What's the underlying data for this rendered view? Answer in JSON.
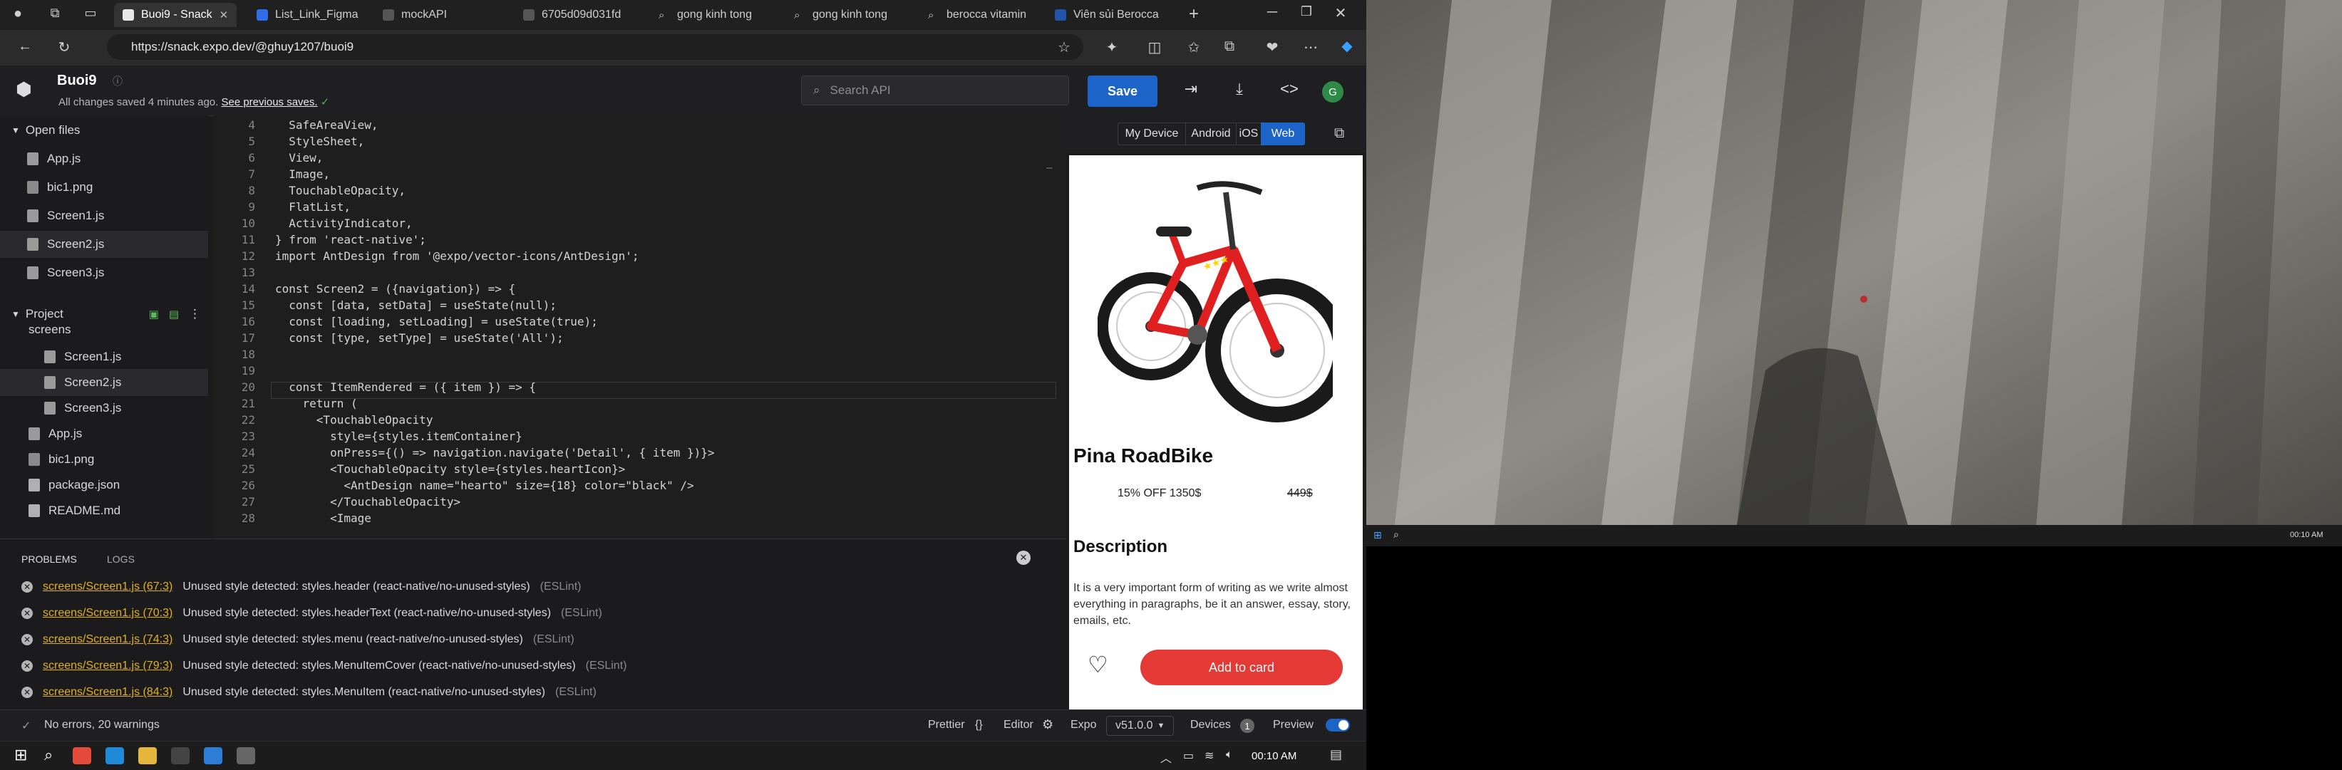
{
  "browser": {
    "tabs": [
      {
        "title": "Buoi9 - Snack",
        "active": true
      },
      {
        "title": "List_Link_Figma"
      },
      {
        "title": "mockAPI"
      },
      {
        "title": "6705d09d031fd"
      },
      {
        "title": "gong kinh tong"
      },
      {
        "title": "gong kinh tong"
      },
      {
        "title": "berocca vitamin"
      },
      {
        "title": "Viên sủi Berocca"
      }
    ],
    "url": "https://snack.expo.dev/@ghuy1207/buoi9"
  },
  "snack": {
    "project_name": "Buoi9",
    "saved_status": "All changes saved 4 minutes ago.",
    "previous_saves_link": "See previous saves.",
    "search_placeholder": "Search API",
    "save_label": "Save",
    "avatar_letter": "G"
  },
  "sidebar": {
    "open_files_title": "Open files",
    "open_files": [
      "App.js",
      "bic1.png",
      "Screen1.js",
      "Screen2.js",
      "Screen3.js"
    ],
    "project_title": "Project",
    "folder_name": "screens",
    "screen_files": [
      "Screen1.js",
      "Screen2.js",
      "Screen3.js"
    ],
    "root_files": [
      "App.js",
      "bic1.png",
      "package.json",
      "README.md"
    ]
  },
  "editor": {
    "lines": [
      {
        "n": "4",
        "text": "  SafeAreaView,"
      },
      {
        "n": "5",
        "text": "  StyleSheet,"
      },
      {
        "n": "6",
        "text": "  View,"
      },
      {
        "n": "7",
        "text": "  Image,"
      },
      {
        "n": "8",
        "text": "  TouchableOpacity,"
      },
      {
        "n": "9",
        "text": "  FlatList,"
      },
      {
        "n": "10",
        "text": "  ActivityIndicator,"
      },
      {
        "n": "11",
        "text": "} from 'react-native';"
      },
      {
        "n": "12",
        "text": "import AntDesign from '@expo/vector-icons/AntDesign';"
      },
      {
        "n": "13",
        "text": ""
      },
      {
        "n": "14",
        "text": "const Screen2 = ({navigation}) => {"
      },
      {
        "n": "15",
        "text": "  const [data, setData] = useState(null);"
      },
      {
        "n": "16",
        "text": "  const [loading, setLoading] = useState(true);"
      },
      {
        "n": "17",
        "text": "  const [type, setType] = useState('All');"
      },
      {
        "n": "18",
        "text": ""
      },
      {
        "n": "19",
        "text": ""
      },
      {
        "n": "20",
        "text": "  const ItemRendered = ({ item }) => {"
      },
      {
        "n": "21",
        "text": "    return ("
      },
      {
        "n": "22",
        "text": "      <TouchableOpacity"
      },
      {
        "n": "23",
        "text": "        style={styles.itemContainer}"
      },
      {
        "n": "24",
        "text": "        onPress={() => navigation.navigate('Detail', { item })}>"
      },
      {
        "n": "25",
        "text": "        <TouchableOpacity style={styles.heartIcon}>"
      },
      {
        "n": "26",
        "text": "          <AntDesign name=\"hearto\" size={18} color=\"black\" />"
      },
      {
        "n": "27",
        "text": "        </TouchableOpacity>"
      },
      {
        "n": "28",
        "text": "        <Image"
      }
    ]
  },
  "problems": {
    "tab_problems": "PROBLEMS",
    "tab_logs": "LOGS",
    "items": [
      {
        "loc": "screens/Screen1.js (67:3)",
        "msg": "Unused style detected: styles.header (react-native/no-unused-styles)",
        "src": "(ESLint)"
      },
      {
        "loc": "screens/Screen1.js (70:3)",
        "msg": "Unused style detected: styles.headerText (react-native/no-unused-styles)",
        "src": "(ESLint)"
      },
      {
        "loc": "screens/Screen1.js (74:3)",
        "msg": "Unused style detected: styles.menu (react-native/no-unused-styles)",
        "src": "(ESLint)"
      },
      {
        "loc": "screens/Screen1.js (79:3)",
        "msg": "Unused style detected: styles.MenuItemCover (react-native/no-unused-styles)",
        "src": "(ESLint)"
      },
      {
        "loc": "screens/Screen1.js (84:3)",
        "msg": "Unused style detected: styles.MenuItem (react-native/no-unused-styles)",
        "src": "(ESLint)"
      }
    ]
  },
  "statusbar": {
    "summary": "No errors, 20 warnings",
    "prettier": "Prettier",
    "editor": "Editor",
    "expo": "Expo",
    "version": "v51.0.0",
    "devices": "Devices",
    "devices_count": "1",
    "preview": "Preview"
  },
  "preview": {
    "tabs": [
      "My Device",
      "Android",
      "iOS",
      "Web"
    ],
    "active_tab": "Web",
    "product_name": "Pina RoadBike",
    "discount": "15% OFF 1350$",
    "old_price": "449$",
    "description_title": "Description",
    "description_text": "It is a very important form of writing as we write almost everything in paragraphs, be it an answer, essay, story, emails, etc.",
    "add_button": "Add to card"
  },
  "taskbar": {
    "time": "00:10 AM",
    "mini_time": "00:10 AM"
  },
  "colors": {
    "accent": "#1d64c8",
    "cta": "#e53935",
    "warning_link": "#e2b01c"
  }
}
